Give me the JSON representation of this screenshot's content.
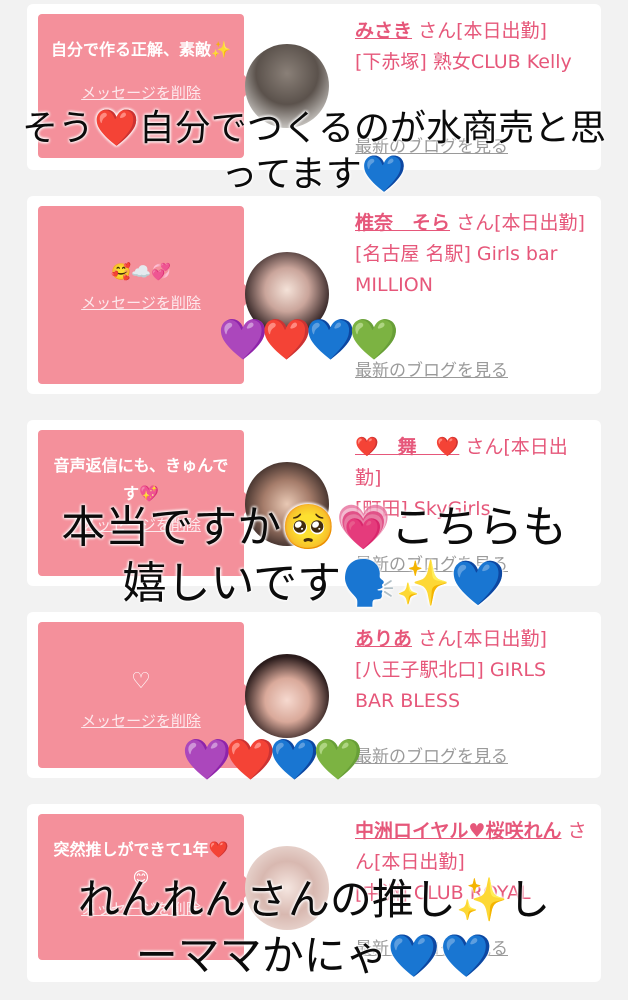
{
  "cards": [
    {
      "message": "自分で作る正解、素敵✨",
      "delete": "メッセージを削除",
      "name": "みさき",
      "san": "さん[本日出勤]",
      "shop": "[下赤塚] 熟女CLUB Kelly",
      "blog": "最新のブログを見る"
    },
    {
      "message": "🥰☁️💞",
      "delete": "メッセージを削除",
      "name": "椎奈　そら",
      "san": "さん[本日出勤]",
      "shop": "[名古屋 名駅] Girls bar MILLION",
      "blog": "最新のブログを見る"
    },
    {
      "message": "音声返信にも、きゅんです💖",
      "delete": "メッセージを削除",
      "name": "❤️　舞　❤️",
      "san": "さん[本日出勤]",
      "shop": "[町田] SkyGirls",
      "blog": "最新のブログを見る"
    },
    {
      "message": "♡",
      "delete": "メッセージを削除",
      "name": "ありあ",
      "san": "さん[本日出勤]",
      "shop": "[八王子駅北口] GIRLS BAR BLESS",
      "blog": "最新のブログを見る"
    },
    {
      "message": "突然推しができて1年❤️😊",
      "delete": "メッセージを削除",
      "name": "中洲ロイヤル♥桜咲れん",
      "san": "さん[本日出勤]",
      "shop": "[中洲] CLUB ROYAL",
      "blog": "最新のブログを見る"
    }
  ],
  "overlays": {
    "text1_line1": "そう❤️自分でつくるのが水商売と思",
    "text1_line2": "ってます💙",
    "hearts1": "💜❤️💙💚",
    "text2_line1": "本当ですか🥺💗こちらも",
    "text2_line2": "嬉しいです🗣️✨💙",
    "hearts2": "💜❤️💙💚",
    "text3_line1": "れんれんさんの推し✨し",
    "text3_line2": "ーママかにゃ💙💙"
  },
  "colors": {
    "bubble": "#f4909b",
    "accent": "#e6577a",
    "card": "#ffffff",
    "background": "#f2f2f2"
  }
}
